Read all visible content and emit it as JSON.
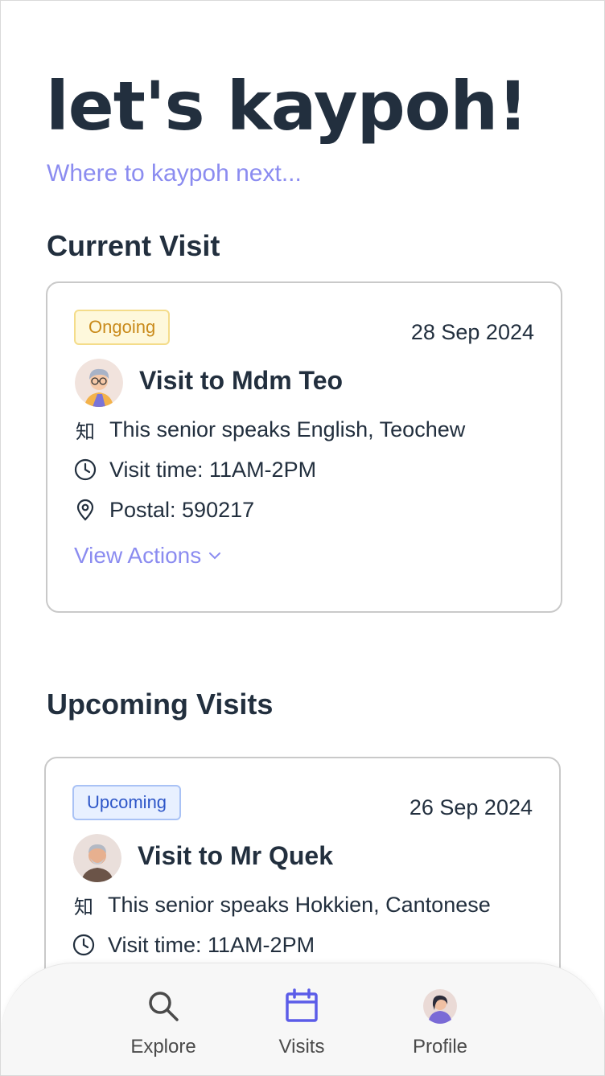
{
  "header": {
    "title": "let's kaypoh!",
    "subtitle": "Where to kaypoh next..."
  },
  "sections": {
    "current": "Current Visit",
    "upcoming": "Upcoming Visits"
  },
  "current_visit": {
    "status": "Ongoing",
    "date": "28 Sep 2024",
    "title": "Visit to Mdm Teo",
    "languages": "This senior speaks English, Teochew",
    "time": "Visit time: 11AM-2PM",
    "postal": "Postal: 590217",
    "actions_label": "View Actions",
    "language_icon": "知"
  },
  "upcoming_visit": {
    "status": "Upcoming",
    "date": "26 Sep 2024",
    "title": "Visit to Mr Quek",
    "languages": "This senior speaks Hokkien, Cantonese",
    "time": "Visit time: 11AM-2PM",
    "language_icon": "知"
  },
  "nav": {
    "explore": "Explore",
    "visits": "Visits",
    "profile": "Profile"
  },
  "colors": {
    "accent": "#8b8cf0",
    "active_nav": "#5b5ce8",
    "text_dark": "#222f3e",
    "ongoing_bg": "#fef8dc",
    "upcoming_bg": "#e8f0ff"
  }
}
